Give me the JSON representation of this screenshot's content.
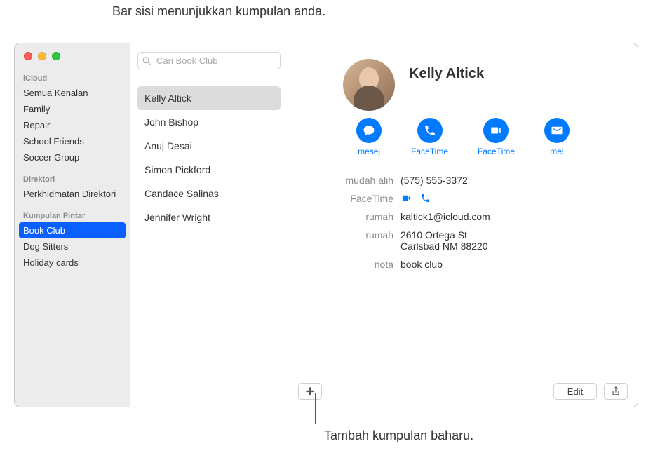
{
  "callouts": {
    "top": "Bar sisi menunjukkan kumpulan anda.",
    "bottom": "Tambah kumpulan baharu."
  },
  "sidebar": {
    "sections": [
      {
        "header": "iCloud",
        "items": [
          {
            "label": "Semua Kenalan",
            "selected": false
          },
          {
            "label": "Family",
            "selected": false
          },
          {
            "label": "Repair",
            "selected": false
          },
          {
            "label": "School Friends",
            "selected": false
          },
          {
            "label": "Soccer Group",
            "selected": false
          }
        ]
      },
      {
        "header": "Direktori",
        "items": [
          {
            "label": "Perkhidmatan Direktori",
            "selected": false
          }
        ]
      },
      {
        "header": "Kumpulan Pintar",
        "items": [
          {
            "label": "Book Club",
            "selected": true
          },
          {
            "label": "Dog Sitters",
            "selected": false
          },
          {
            "label": "Holiday cards",
            "selected": false
          }
        ]
      }
    ]
  },
  "search": {
    "placeholder": "Cari Book Club"
  },
  "contacts": [
    {
      "name": "Kelly Altick",
      "selected": true
    },
    {
      "name": "John Bishop",
      "selected": false
    },
    {
      "name": "Anuj Desai",
      "selected": false
    },
    {
      "name": "Simon Pickford",
      "selected": false
    },
    {
      "name": "Candace Salinas",
      "selected": false
    },
    {
      "name": "Jennifer Wright",
      "selected": false
    }
  ],
  "detail": {
    "name": "Kelly Altick",
    "actions": [
      {
        "label": "mesej",
        "icon": "message"
      },
      {
        "label": "FaceTime",
        "icon": "phone"
      },
      {
        "label": "FaceTime",
        "icon": "video"
      },
      {
        "label": "mel",
        "icon": "mail"
      }
    ],
    "fields": [
      {
        "label": "mudah alih",
        "value": "(575) 555-3372",
        "type": "text"
      },
      {
        "label": "FaceTime",
        "value": "",
        "type": "facetime"
      },
      {
        "label": "rumah",
        "value": "kaltick1@icloud.com",
        "type": "text"
      },
      {
        "label": "rumah",
        "value": "2610 Ortega St\nCarlsbad NM 88220",
        "type": "text"
      },
      {
        "label": "nota",
        "value": "book club",
        "type": "text"
      }
    ]
  },
  "buttons": {
    "edit": "Edit"
  }
}
